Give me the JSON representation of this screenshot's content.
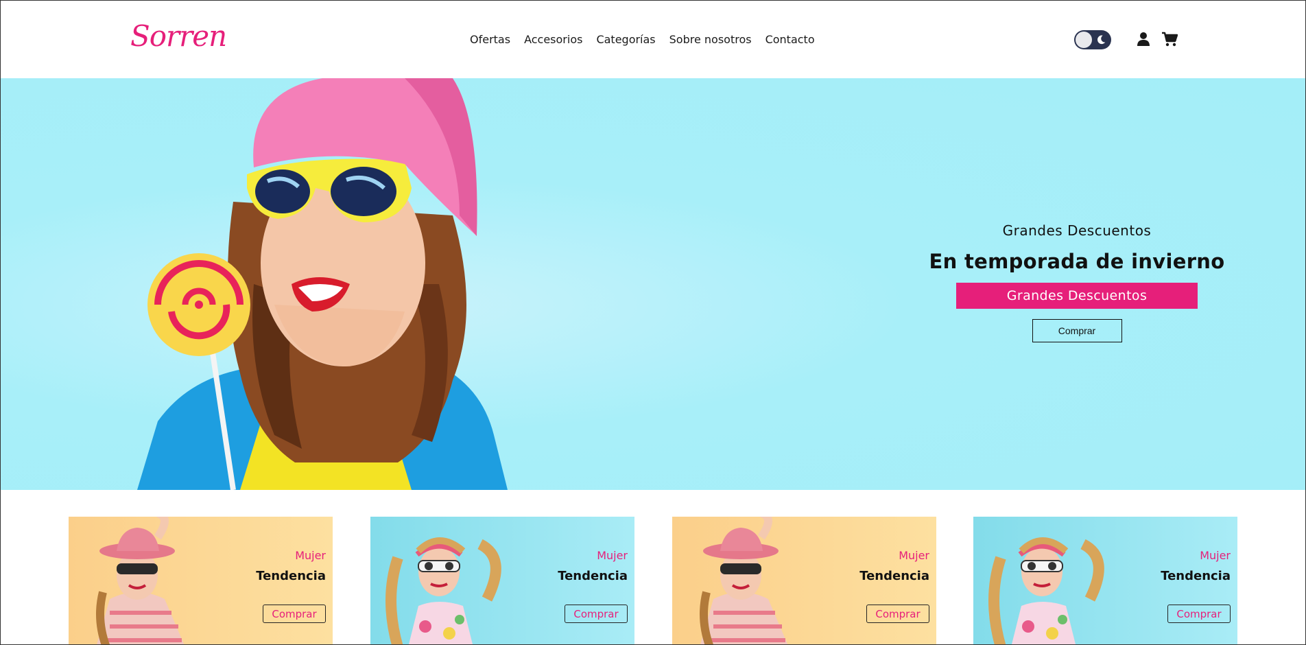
{
  "brand": {
    "logo_text": "Sorren",
    "accent": "#e61f7a"
  },
  "nav": {
    "items": [
      {
        "label": "Ofertas"
      },
      {
        "label": "Accesorios"
      },
      {
        "label": "Categorías"
      },
      {
        "label": "Sobre nosotros"
      },
      {
        "label": "Contacto"
      }
    ]
  },
  "header_icons": {
    "theme_toggle": {
      "icon": "moon-icon",
      "state": "dark-mode-off"
    },
    "user": {
      "icon": "user-icon"
    },
    "cart": {
      "icon": "cart-icon"
    }
  },
  "hero": {
    "background": "#a4eef8",
    "subtitle": "Grandes Descuentos",
    "title": "En temporada de invierno",
    "badge": "Grandes Descuentos",
    "button": "Comprar"
  },
  "cards": [
    {
      "category": "Mujer",
      "title": "Tendencia",
      "button": "Comprar",
      "theme": "warm"
    },
    {
      "category": "Mujer",
      "title": "Tendencia",
      "button": "Comprar",
      "theme": "cool"
    },
    {
      "category": "Mujer",
      "title": "Tendencia",
      "button": "Comprar",
      "theme": "warm"
    },
    {
      "category": "Mujer",
      "title": "Tendencia",
      "button": "Comprar",
      "theme": "cool"
    }
  ]
}
